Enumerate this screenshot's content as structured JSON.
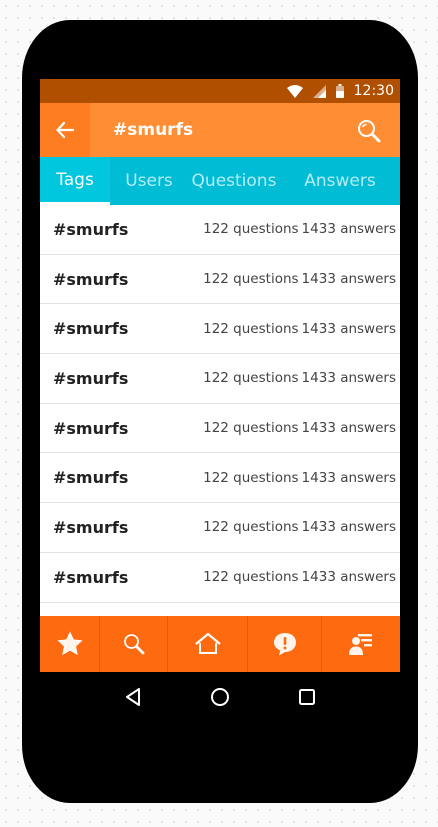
{
  "status_bar": {
    "time": "12:30"
  },
  "search": {
    "query": "#smurfs"
  },
  "tabs": [
    {
      "label": "Tags",
      "active": true
    },
    {
      "label": "Users",
      "active": false
    },
    {
      "label": "Questions",
      "active": false
    },
    {
      "label": "Answers",
      "active": false
    }
  ],
  "results": [
    {
      "tag": "#smurfs",
      "questions": "122 questions",
      "answers": "1433 answers"
    },
    {
      "tag": "#smurfs",
      "questions": "122 questions",
      "answers": "1433 answers"
    },
    {
      "tag": "#smurfs",
      "questions": "122 questions",
      "answers": "1433 answers"
    },
    {
      "tag": "#smurfs",
      "questions": "122 questions",
      "answers": "1433 answers"
    },
    {
      "tag": "#smurfs",
      "questions": "122 questions",
      "answers": "1433 answers"
    },
    {
      "tag": "#smurfs",
      "questions": "122 questions",
      "answers": "1433 answers"
    },
    {
      "tag": "#smurfs",
      "questions": "122 questions",
      "answers": "1433 answers"
    },
    {
      "tag": "#smurfs",
      "questions": "122 questions",
      "answers": "1433 answers"
    }
  ],
  "bottom_nav": [
    "star-icon",
    "search-icon",
    "home-icon",
    "alert-bubble-icon",
    "user-list-icon"
  ],
  "colors": {
    "app_bar": "#fe7d21",
    "status_bar": "#b14f00",
    "tab_bar": "#00bcd4",
    "bottom_nav": "#fe6a10"
  }
}
